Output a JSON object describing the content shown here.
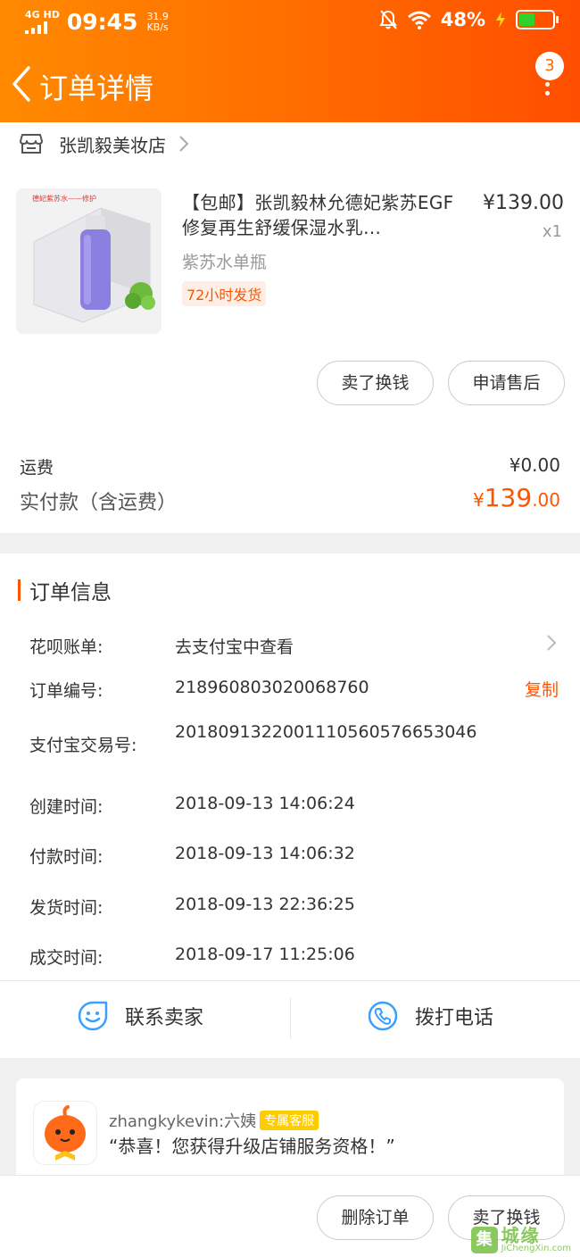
{
  "status_bar": {
    "network": "4G HD",
    "time": "09:45",
    "speed_value": "31.9",
    "speed_unit": "KB/s",
    "battery_percent": "48%",
    "battery_level": 0.48
  },
  "nav": {
    "title": "订单详情",
    "badge_count": "3"
  },
  "shop": {
    "name": "张凯毅美妆店"
  },
  "product": {
    "title": "【包邮】张凯毅林允德妃紫苏EGF修复再生舒缓保湿水乳…",
    "price": "¥139.00",
    "qty": "x1",
    "variant": "紫苏水单瓶",
    "ship_tag": "72小时发货",
    "image_caption": "德妃紫苏水——修护"
  },
  "actions": {
    "sell": "卖了换钱",
    "after_sale": "申请售后"
  },
  "fees": {
    "shipping_label": "运费",
    "shipping_value": "¥0.00",
    "paid_label": "实付款（含运费）",
    "paid_currency": "¥",
    "paid_int": "139",
    "paid_dec": ".00"
  },
  "order_info": {
    "title": "订单信息",
    "rows": [
      {
        "label": "花呗账单:",
        "value": "去支付宝中查看"
      },
      {
        "label": "订单编号:",
        "value": "218960803020068760"
      },
      {
        "label": "支付宝交易号:",
        "value": "2018091322001110560576653046"
      },
      {
        "label": "创建时间:",
        "value": "2018-09-13 14:06:24"
      },
      {
        "label": "付款时间:",
        "value": "2018-09-13 14:06:32"
      },
      {
        "label": "发货时间:",
        "value": "2018-09-13 22:36:25"
      },
      {
        "label": "成交时间:",
        "value": "2018-09-17 11:25:06"
      }
    ],
    "copy": "复制",
    "contact_seller": "联系卖家",
    "call": "拨打电话"
  },
  "chat": {
    "name": "zhangkykevin:六姨",
    "tag": "专属客服",
    "message": "“恭喜！您获得升级店铺服务资格！”"
  },
  "bottom": {
    "delete": "删除订单",
    "sell": "卖了换钱"
  },
  "watermark": {
    "cn": "城缘",
    "en": "JiChengXin.com",
    "logo": "集"
  },
  "colors": {
    "accent": "#ff5500",
    "header_start": "#ff8a00",
    "header_end": "#ff4e00",
    "blue_icon": "#3aa0ff"
  }
}
